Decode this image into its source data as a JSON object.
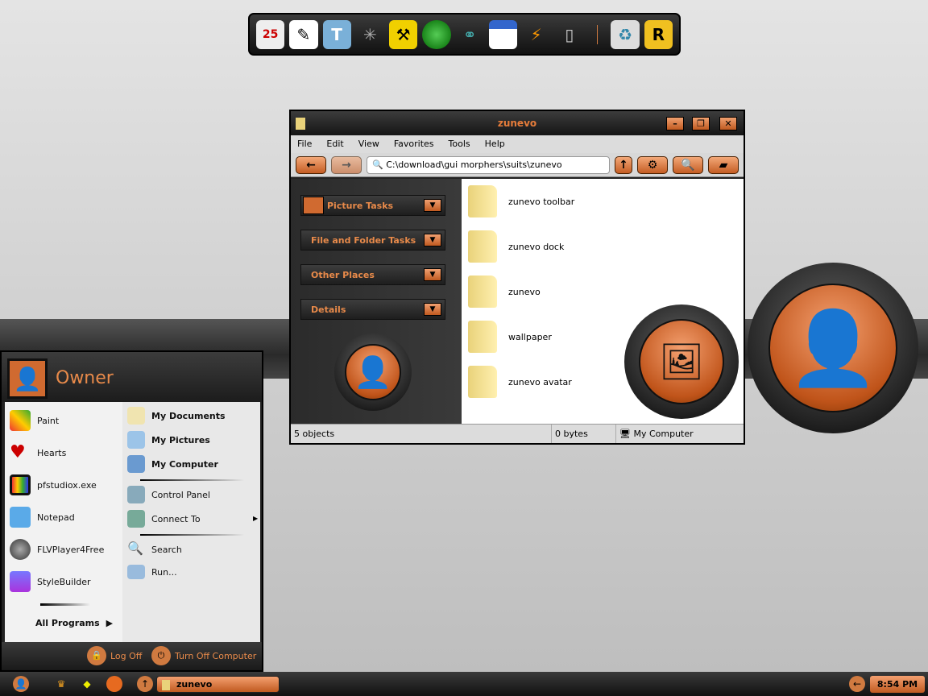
{
  "dock": {
    "icons": [
      "calendar-icon",
      "pen-tool-icon",
      "text-editor-icon",
      "spider-web-icon",
      "hammer-icon",
      "green-orb-icon",
      "network-icon",
      "calendar-window-icon",
      "winamp-icon",
      "pda-icon",
      "recycle-bin-icon",
      "r-app-icon"
    ],
    "calendar_day": "25",
    "r_label": "R"
  },
  "window": {
    "title": "zunevo",
    "menu": [
      "File",
      "Edit",
      "View",
      "Favorites",
      "Tools",
      "Help"
    ],
    "address": "C:\\download\\gui morphers\\suits\\zunevo",
    "tasks": [
      "Picture Tasks",
      "File and Folder Tasks",
      "Other Places",
      "Details"
    ],
    "files": [
      "zunevo toolbar",
      "zunevo dock",
      "zunevo",
      "wallpaper",
      "zunevo avatar"
    ],
    "status": {
      "objects": "5 objects",
      "size": "0 bytes",
      "location": "My Computer"
    }
  },
  "start_menu": {
    "user": "Owner",
    "left": [
      "Paint",
      "Hearts",
      "pfstudiox.exe",
      "Notepad",
      "FLVPlayer4Free",
      "StyleBuilder"
    ],
    "all_programs": "All Programs",
    "right": [
      "My Documents",
      "My Pictures",
      "My Computer",
      "Control Panel",
      "Connect To",
      "Search",
      "Run..."
    ],
    "log_off": "Log Off",
    "turn_off": "Turn Off Computer"
  },
  "taskbar": {
    "task": "zunevo",
    "clock": "8:54 PM"
  },
  "colors": {
    "accent": "#e07a3a",
    "dark": "#222222"
  }
}
